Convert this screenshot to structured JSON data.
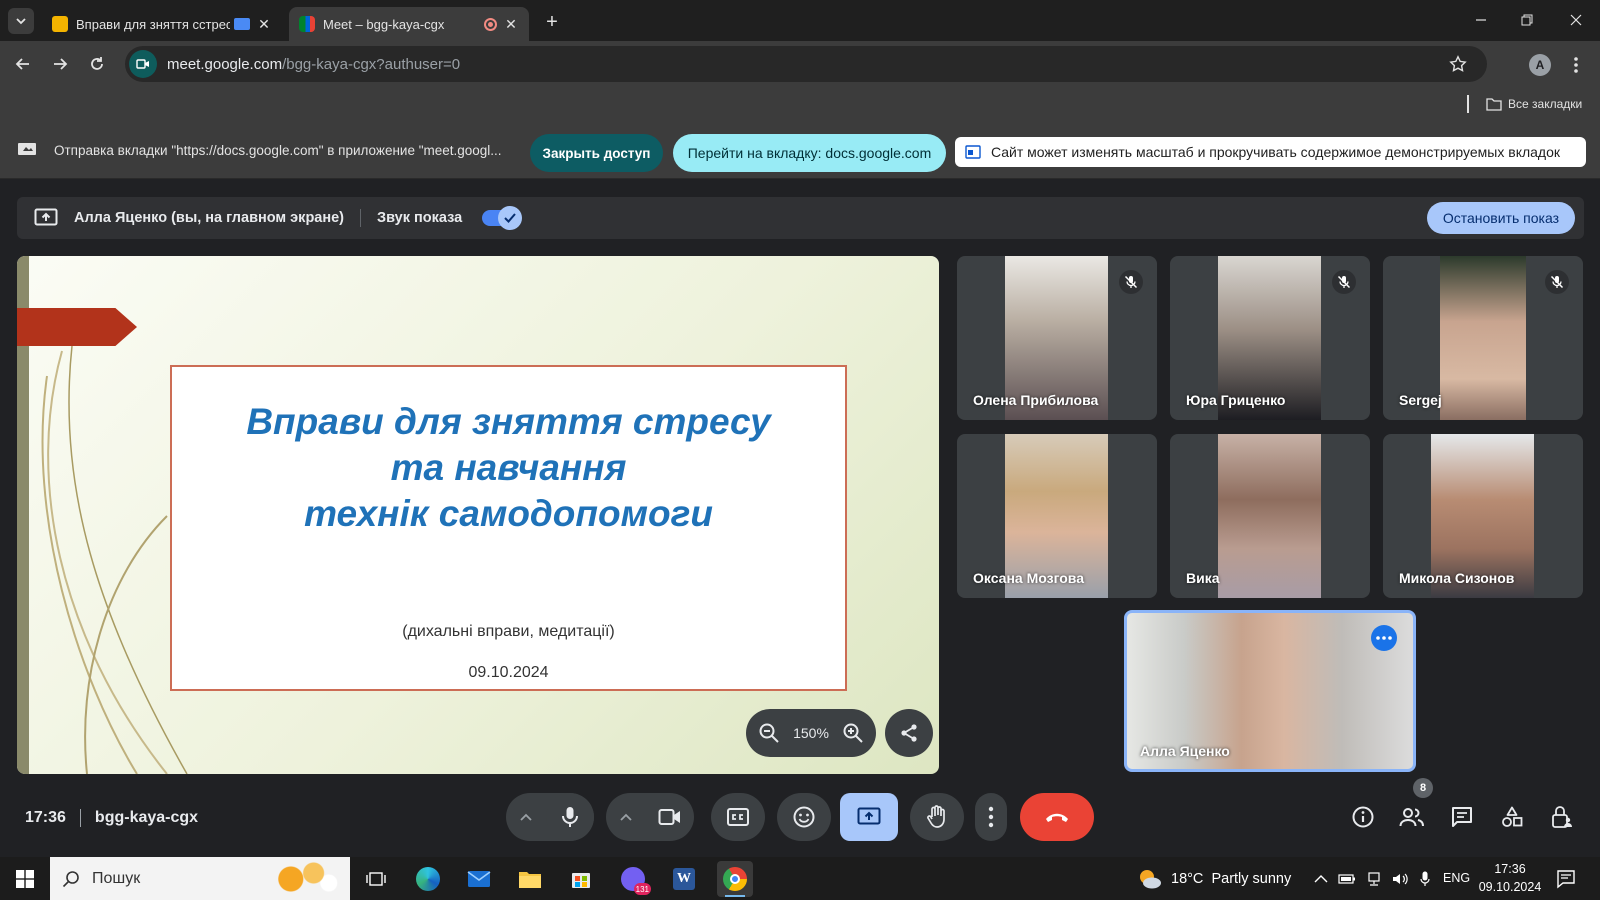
{
  "browser": {
    "tabs": [
      {
        "title": "Вправи для зняття сстресу",
        "active": false
      },
      {
        "title": "Meet – bgg-kaya-cgx",
        "active": true
      }
    ],
    "url_host": "meet.google.com",
    "url_path": "/bgg-kaya-cgx?authuser=0",
    "profile_initial": "A",
    "bookmarks_label": "Все закладки"
  },
  "infobar": {
    "message": "Отправка вкладки \"https://docs.google.com\" в приложение \"meet.googl...",
    "close_access": "Закрыть доступ",
    "go_to_tab": "Перейти на вкладку: docs.google.com",
    "zoom_notice": "Сайт может изменять масштаб и прокручивать содержимое демонстрируемых вкладок"
  },
  "sharebar": {
    "presenter": "Алла Яценко (вы, на главном экране)",
    "sound_label": "Звук показа",
    "sound_on": true,
    "stop_button": "Остановить показ"
  },
  "slide": {
    "title_line1": "Вправи для зняття стресу",
    "title_line2": "та навчання",
    "title_line3": "технік самодопомоги",
    "subtitle": "(дихальні вправи, медитації)",
    "date": "09.10.2024",
    "zoom_level": "150%"
  },
  "participants": [
    {
      "name": "Олена Прибилова",
      "muted": true
    },
    {
      "name": "Юра Гриценко",
      "muted": true
    },
    {
      "name": "Sergej",
      "muted": true
    },
    {
      "name": "Оксана Мозгова",
      "muted": false
    },
    {
      "name": "Вика",
      "muted": false
    },
    {
      "name": "Микола Сизонов",
      "muted": false
    }
  ],
  "self_tile": {
    "name": "Алла Яценко"
  },
  "meeting": {
    "time": "17:36",
    "code": "bgg-kaya-cgx",
    "participant_count": "8"
  },
  "colors": {
    "accent": "#8ab4f8",
    "end_call": "#ea4335",
    "present_active": "#a8c7fa",
    "teal_button": "#0d5c63",
    "slide_title": "#1f72b8"
  },
  "taskbar": {
    "search_placeholder": "Пошук",
    "weather": "18°C  Partly sunny",
    "language": "ENG",
    "clock_time": "17:36",
    "clock_date": "09.10.2024",
    "viber_badge": "131"
  }
}
